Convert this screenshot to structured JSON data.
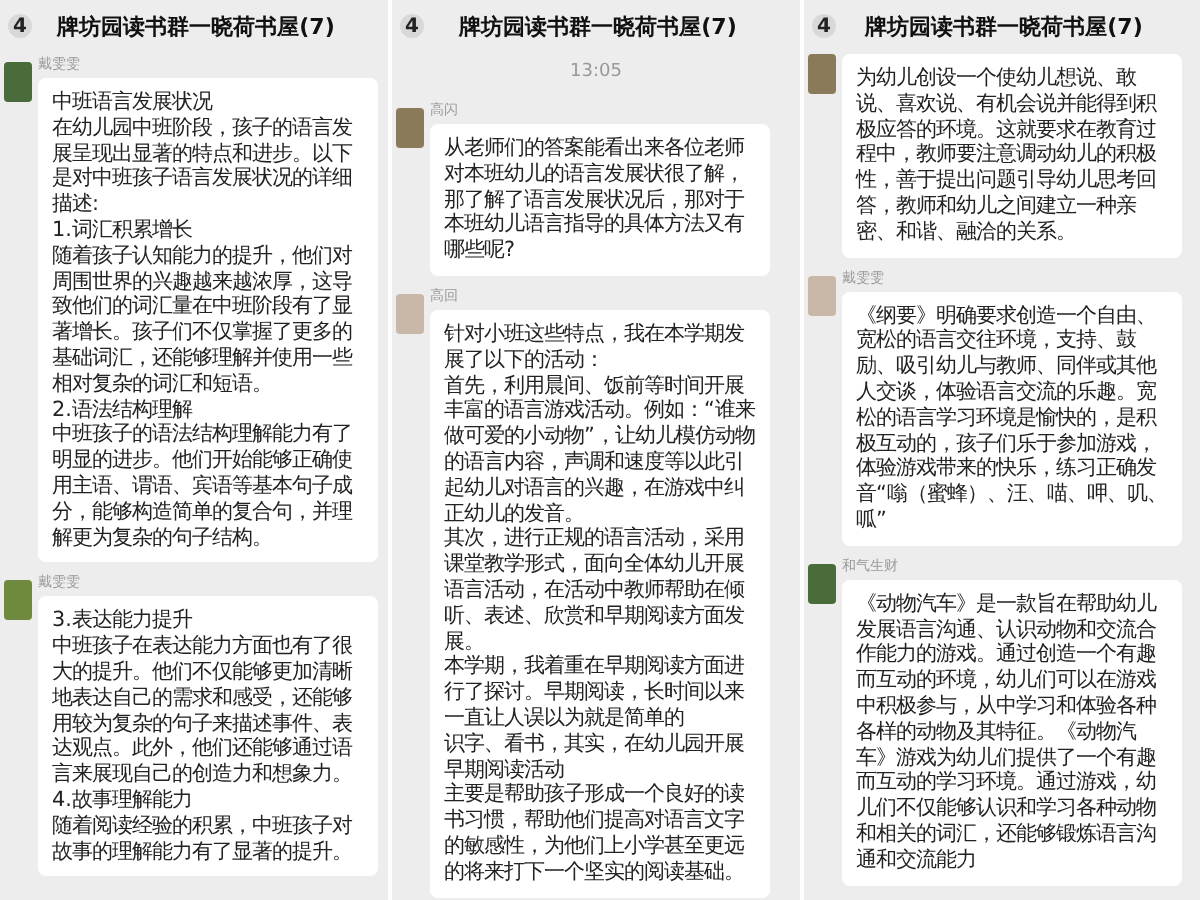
{
  "panels": [
    {
      "back_count": "4",
      "title": "牌坊园读书群一晓荷书屋(7)",
      "items": [
        {
          "kind": "message",
          "sender": "戴雯雯",
          "paragraphs": [
            "中班语言发展状况",
            "在幼儿园中班阶段，孩子的语言发展呈现出显著的特点和进步。以下是对中班孩子语言发展状况的详细描述:",
            "1.词汇积累增长",
            "随着孩子认知能力的提升，他们对周围世界的兴趣越来越浓厚，这导致他们的词汇量在中班阶段有了显著增长。孩子们不仅掌握了更多的基础词汇，还能够理解并使用一些相对复杂的词汇和短语。",
            "2.语法结构理解",
            "中班孩子的语法结构理解能力有了明显的进步。他们开始能够正确使用主语、谓语、宾语等基本句子成分，能够构造简单的复合句，并理解更为复杂的句子结构。"
          ]
        },
        {
          "kind": "message",
          "sender": "戴雯雯",
          "paragraphs": [
            "3.表达能力提升",
            "中班孩子在表达能力方面也有了很大的提升。他们不仅能够更加清晰地表达自己的需求和感受，还能够用较为复杂的句子来描述事件、表达观点。此外，他们还能够通过语言来展现自己的创造力和想象力。",
            "4.故事理解能力",
            "随着阅读经验的积累，中班孩子对故事的理解能力有了显著的提升。"
          ]
        }
      ]
    },
    {
      "back_count": "4",
      "title": "牌坊园读书群一晓荷书屋(7)",
      "items": [
        {
          "kind": "time",
          "text": "13:05"
        },
        {
          "kind": "message",
          "sender": "高闪",
          "paragraphs": [
            "从老师们的答案能看出来各位老师对本班幼儿的语言发展状很了解，那了解了语言发展状况后，那对于本班幼儿语言指导的具体方法又有哪些呢?"
          ]
        },
        {
          "kind": "message",
          "sender": "高回",
          "paragraphs": [
            "针对小班这些特点，我在本学期发展了以下的活动：",
            "首先，利用晨间、饭前等时间开展丰富的语言游戏活动。例如：“谁来做可爱的小动物”，让幼儿模仿动物的语言内容，声调和速度等以此引起幼儿对语言的兴趣，在游戏中纠正幼儿的发音。",
            "其次，进行正规的语言活动，采用课堂教学形式，面向全体幼儿开展语言活动，在活动中教师帮助在倾听、表述、欣赏和早期阅读方面发展。",
            "本学期，我着重在早期阅读方面进行了探讨。早期阅读，长时间以来一直让人误以为就是简单的",
            "识字、看书，其实，在幼儿园开展早期阅读活动",
            "主要是帮助孩子形成一个良好的读书习惯，帮助他们提高对语言文字的敏感性，为他们上小学甚至更远的将来打下一个坚实的阅读基础。"
          ]
        }
      ]
    },
    {
      "back_count": "4",
      "title": "牌坊园读书群一晓荷书屋(7)",
      "items": [
        {
          "kind": "message",
          "paragraphs": [
            "为幼儿创设一个使幼儿想说、敢说、喜欢说、有机会说并能得到积极应答的环境。这就要求在教育过程中，教师要注意调动幼儿的积极性，善于提出问题引导幼儿思考回答，教师和幼儿之间建立一种亲密、和谐、融洽的关系。"
          ]
        },
        {
          "kind": "message",
          "sender": "戴雯雯",
          "paragraphs": [
            "《纲要》明确要求创造一个自由、宽松的语言交往环境，支持、鼓励、吸引幼儿与教师、同伴或其他人交谈，体验语言交流的乐趣。宽松的语言学习环境是愉快的，是积极互动的，孩子们乐于参加游戏，体验游戏带来的快乐，练习正确发音“嗡（蜜蜂）、汪、喵、呷、叽、呱”"
          ]
        },
        {
          "kind": "message",
          "sender": "和气生财",
          "paragraphs": [
            "《动物汽车》是一款旨在帮助幼儿发展语言沟通、认识动物和交流合作能力的游戏。通过创造一个有趣而互动的环境，幼儿们可以在游戏中积极参与，从中学习和体验各种各样的动物及其特征。《动物汽车》游戏为幼儿们提供了一个有趣而互动的学习环境。通过游戏，幼儿们不仅能够认识和学习各种动物和相关的词汇，还能够锻炼语言沟通和交流能力"
          ]
        }
      ]
    }
  ]
}
